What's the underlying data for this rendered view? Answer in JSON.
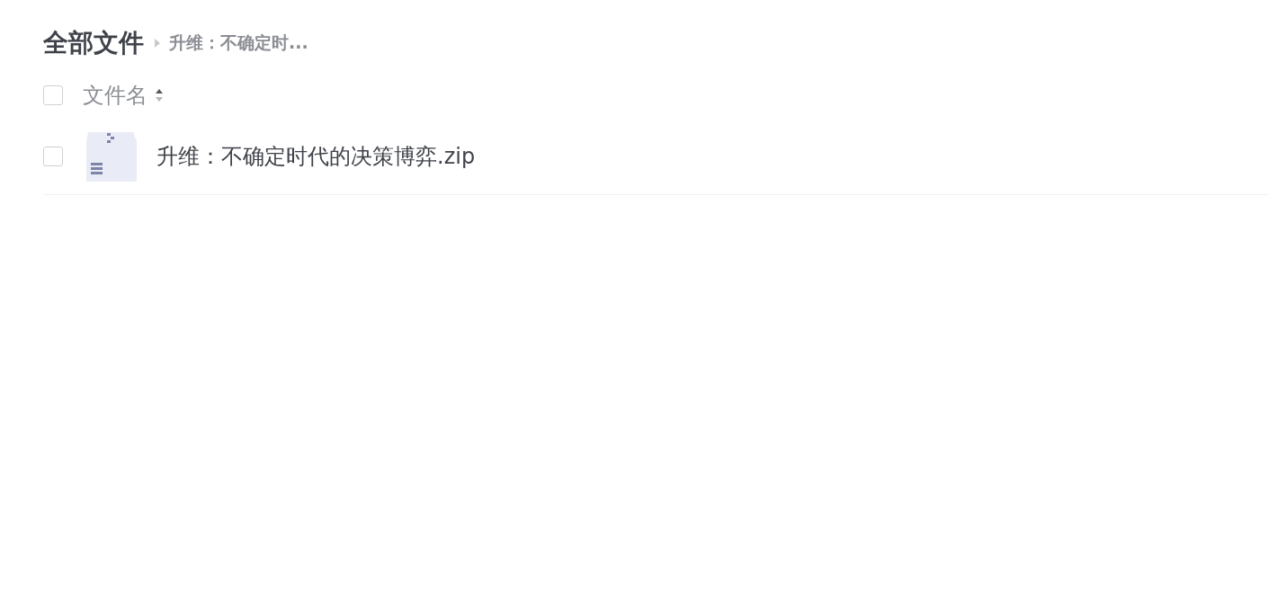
{
  "breadcrumb": {
    "root": "全部文件",
    "current": "升维：不确定时..."
  },
  "header": {
    "select_all_checked": false,
    "column": "文件名"
  },
  "files": [
    {
      "name": "升维：不确定时代的决策博弈.zip",
      "checked": false,
      "kind": "zip"
    }
  ]
}
